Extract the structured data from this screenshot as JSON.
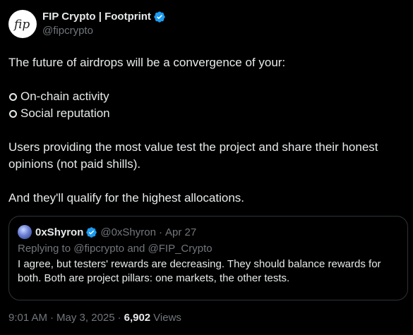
{
  "author": {
    "display_name": "FIP Crypto | Footprint",
    "handle": "@fipcrypto",
    "avatar_text": "fip"
  },
  "tweet": {
    "line1": "The future of airdrops will be a convergence of your:",
    "bullets": [
      "On-chain activity",
      "Social reputation"
    ],
    "paragraph2": "Users providing the most value test the project and share their honest opinions (not paid shills).",
    "paragraph3": "And they'll qualify for the highest allocations."
  },
  "quote": {
    "display_name": "0xShyron",
    "handle": "@0xShyron",
    "separator": "·",
    "date": "Apr 27",
    "replying_prefix": "Replying to",
    "replying_to_1": "@fipcrypto",
    "replying_and": "and",
    "replying_to_2": "@FIP_Crypto",
    "text": "I agree, but testers' rewards are decreasing. They should balance rewards for both. Both are project pillars: one markets, the other tests."
  },
  "meta": {
    "time": "9:01 AM",
    "date": "May 3, 2025",
    "separator": "·",
    "views_count": "6,902",
    "views_label": "Views"
  },
  "colors": {
    "background": "#000000",
    "text": "#e7e9ea",
    "secondary": "#71767b",
    "verified": "#1d9bf0",
    "border": "#2f3336"
  },
  "icons": {
    "verified": "verified-badge-icon",
    "bullet": "circle-bullet-icon"
  }
}
